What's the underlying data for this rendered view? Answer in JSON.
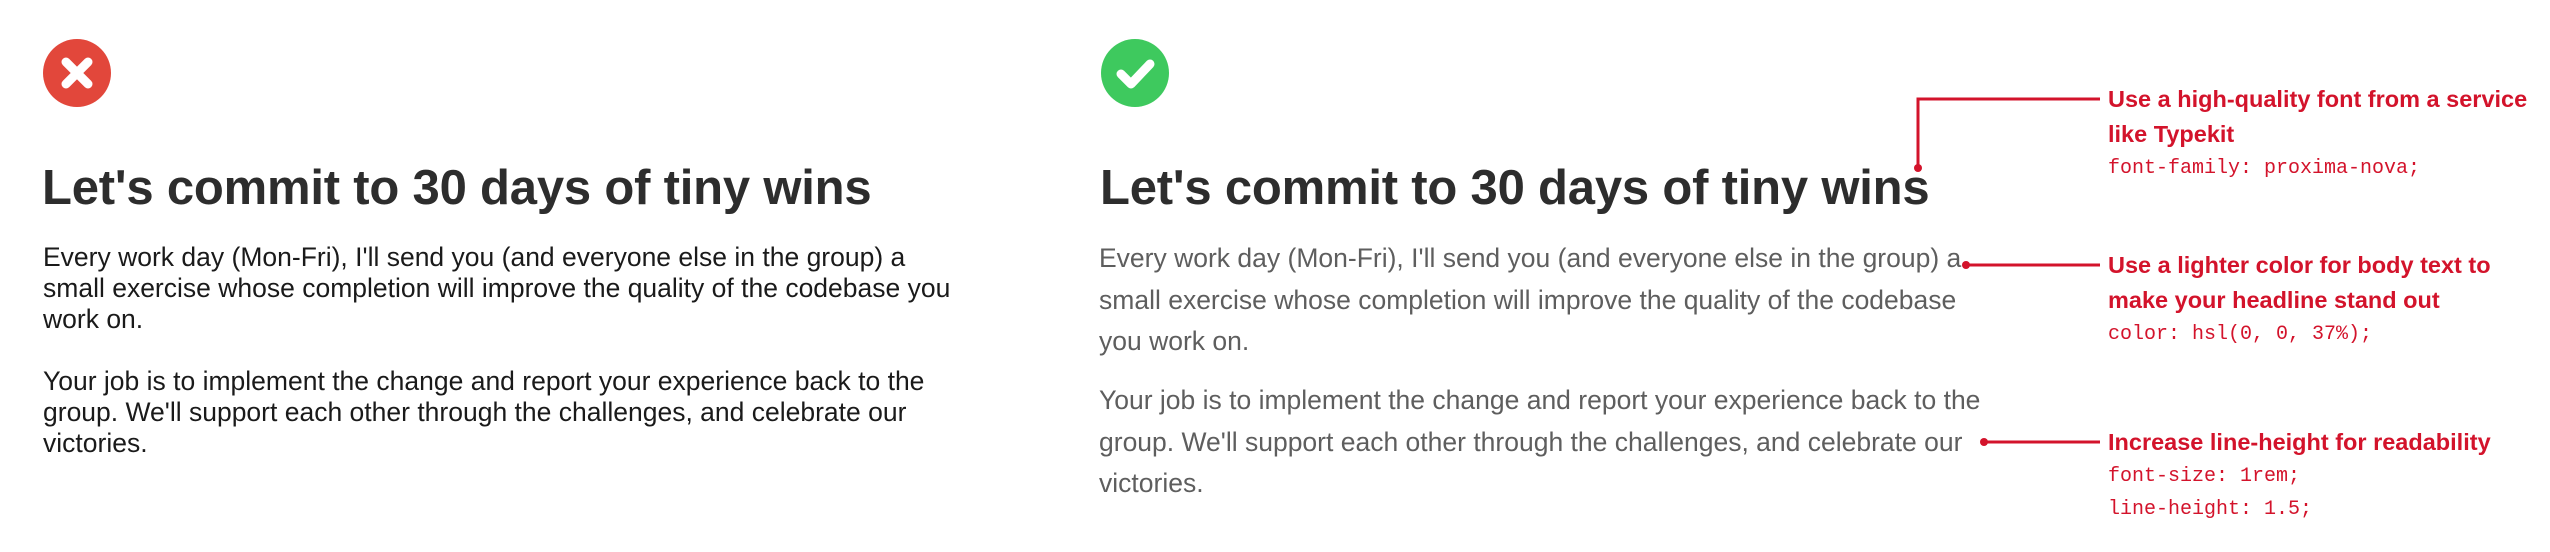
{
  "colors": {
    "bad_badge": "#e2473b",
    "good_badge": "#3ec95e",
    "annotation": "#d3132b",
    "headline": "#2d2d2d",
    "bad_body": "#1a1a1a",
    "good_body": "#5e5e5e"
  },
  "icons": {
    "bad": "x-mark-icon",
    "good": "checkmark-icon"
  },
  "bad_example": {
    "headline": "Let's commit to 30 days of tiny wins",
    "paragraph_1": "Every work day (Mon-Fri), I'll send you (and everyone else in the group) a small exercise whose completion will improve the quality of the codebase you work on.",
    "paragraph_2": "Your job is to implement the change and report your experience back to the group. We'll support each other through the challenges, and celebrate our victories."
  },
  "good_example": {
    "headline": "Let's commit to 30 days of tiny wins",
    "paragraph_1": "Every work day (Mon-Fri), I'll send you (and everyone else in the group) a small exercise whose completion will improve the quality of the codebase you work on.",
    "paragraph_2": "Your job is to implement the change and report your experience back to the group. We'll support each other through the challenges, and celebrate our victories."
  },
  "annotations": [
    {
      "title": "Use a high-quality font from a service like Typekit",
      "code": "font-family: proxima-nova;"
    },
    {
      "title": "Use a lighter color for body text to make your headline stand out",
      "code": "color: hsl(0, 0, 37%);"
    },
    {
      "title": "Increase line-height for readability",
      "code": "font-size: 1rem;\nline-height: 1.5;"
    }
  ]
}
